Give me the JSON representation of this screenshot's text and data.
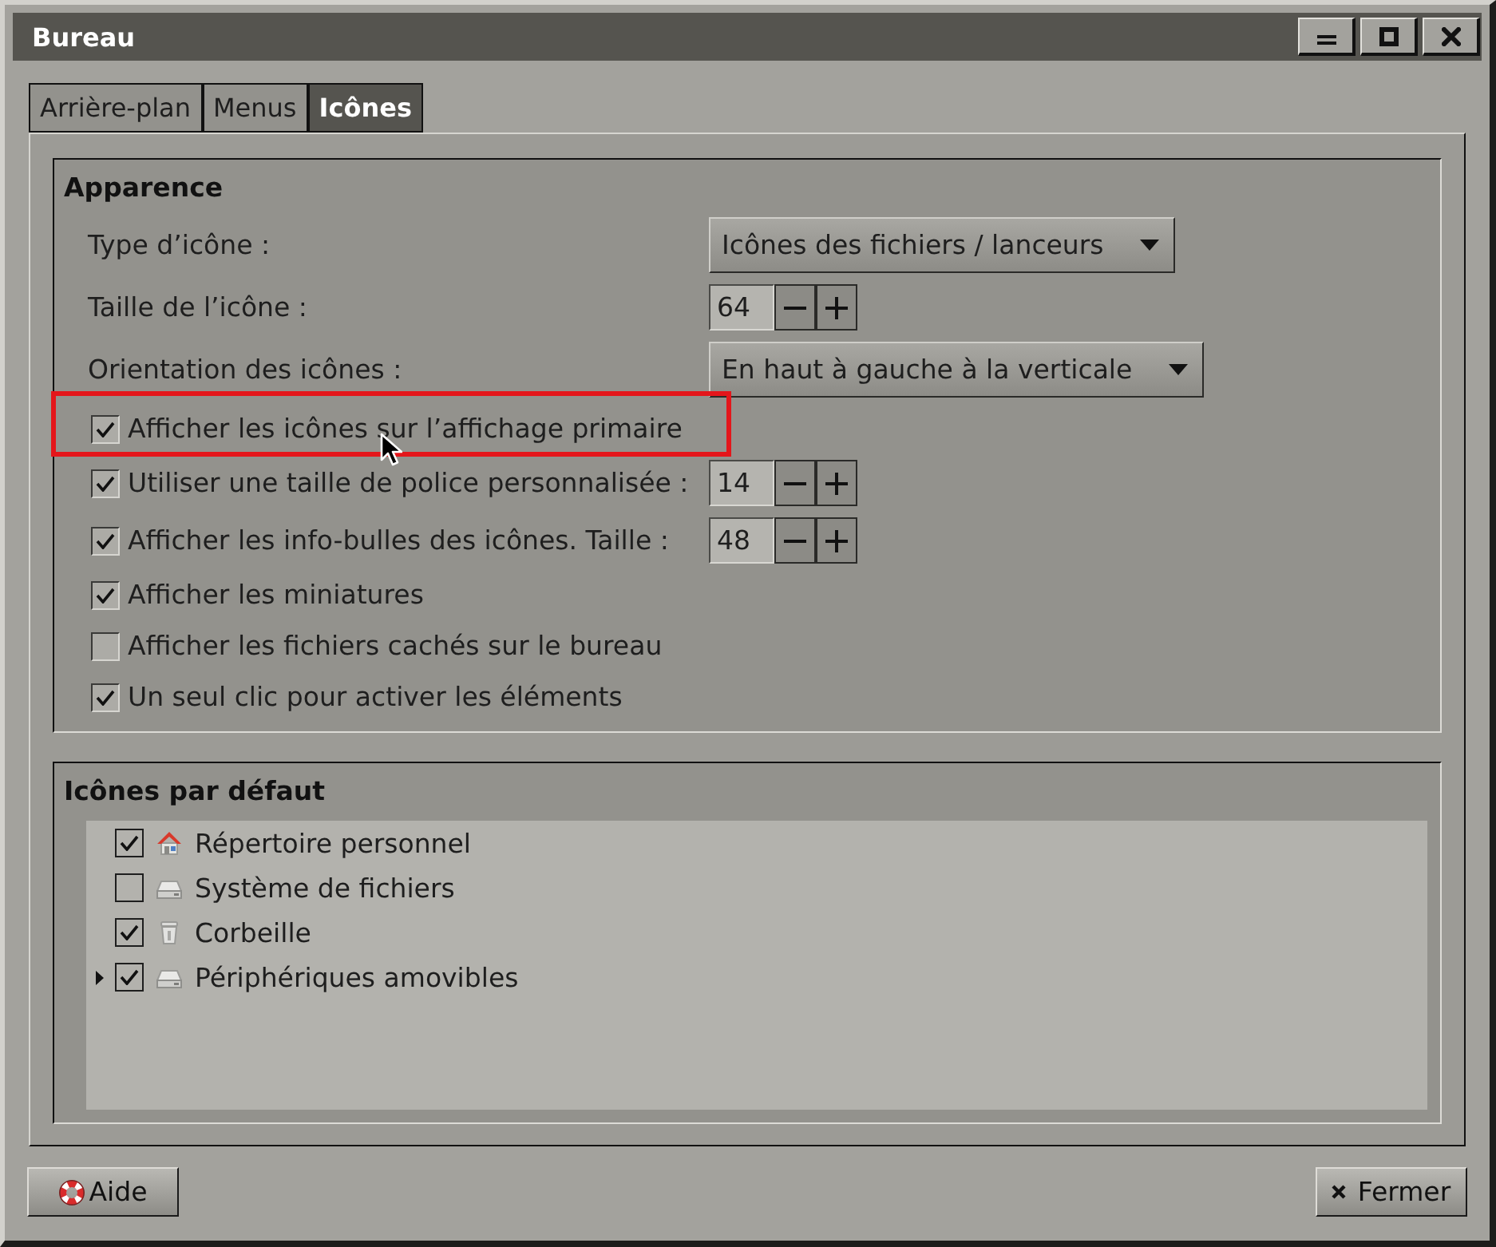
{
  "window": {
    "title": "Bureau",
    "controls": [
      {
        "kind": "menu"
      },
      {
        "kind": "maximize"
      },
      {
        "kind": "close"
      }
    ]
  },
  "tabs": [
    {
      "label": "Arrière-plan",
      "selected": false
    },
    {
      "label": "Menus",
      "selected": false
    },
    {
      "label": "Icônes",
      "selected": true
    }
  ],
  "appearance": {
    "title": "Apparence",
    "rows": [
      {
        "kind": "dropdown",
        "label": "Type d’icône :",
        "value": "Icônes des fichiers / lanceurs",
        "highlighted": false,
        "pointer": false
      },
      {
        "kind": "spin",
        "label": "Taille de l’icône :",
        "value": "64",
        "highlighted": false,
        "pointer": false
      },
      {
        "kind": "dropdown",
        "label": "Orientation des icônes :",
        "value": "En haut à gauche à la verticale",
        "highlighted": false,
        "pointer": false
      },
      {
        "kind": "check",
        "label": "Afficher les icônes sur l’affichage primaire",
        "checked": true,
        "highlighted": true,
        "pointer": true
      },
      {
        "kind": "check_spin",
        "label": "Utiliser une taille de police personnalisée :",
        "checked": true,
        "value": "14",
        "highlighted": false,
        "pointer": false
      },
      {
        "kind": "check_spin",
        "label": "Afficher les info-bulles des icônes. Taille :",
        "checked": true,
        "value": "48",
        "highlighted": false,
        "pointer": false
      },
      {
        "kind": "check",
        "label": "Afficher les miniatures",
        "checked": true,
        "highlighted": false,
        "pointer": false
      },
      {
        "kind": "check",
        "label": "Afficher les fichiers cachés sur le bureau",
        "checked": false,
        "highlighted": false,
        "pointer": false
      },
      {
        "kind": "check",
        "label": "Un seul clic pour activer les éléments",
        "checked": true,
        "highlighted": false,
        "pointer": false
      }
    ]
  },
  "defaults": {
    "title": "Icônes par défaut",
    "items": [
      {
        "label": "Répertoire personnel",
        "checked": true,
        "expandable": false
      },
      {
        "label": "Système de fichiers",
        "checked": false,
        "expandable": false
      },
      {
        "label": "Corbeille",
        "checked": true,
        "expandable": false
      },
      {
        "label": "Périphériques amovibles",
        "checked": true,
        "expandable": true,
        "expanded": false
      }
    ]
  },
  "buttons": [
    {
      "kind": "help",
      "label": "Aide"
    },
    {
      "kind": "close",
      "label": "Fermer"
    }
  ]
}
